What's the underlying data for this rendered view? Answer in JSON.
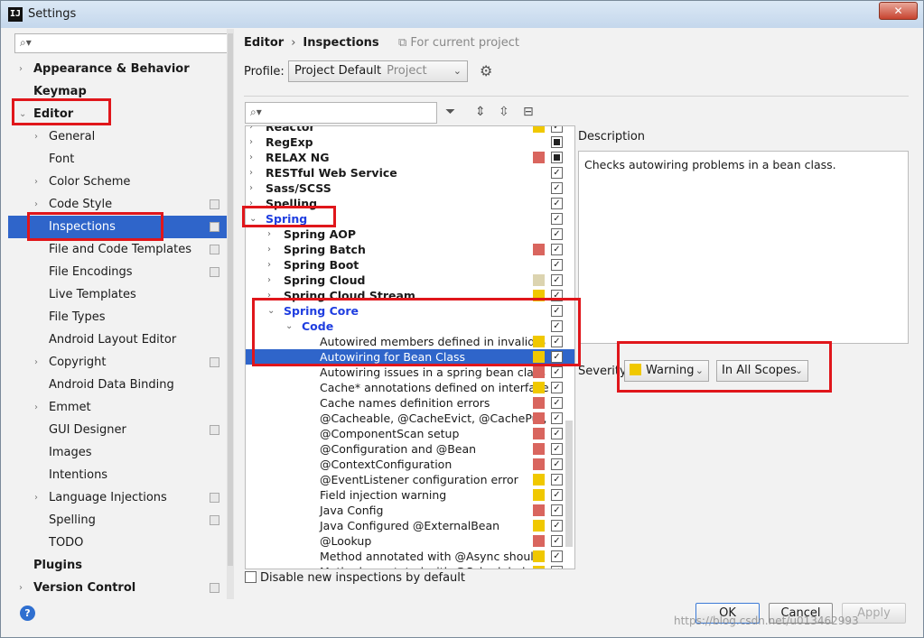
{
  "window": {
    "title": "Settings",
    "app_icon": "IJ",
    "close": "✕"
  },
  "left": {
    "search_placeholder": "",
    "items": [
      {
        "label": "Appearance & Behavior",
        "bold": true,
        "arrow": "›",
        "level": 0
      },
      {
        "label": "Keymap",
        "bold": true,
        "arrow": "",
        "level": 0
      },
      {
        "label": "Editor",
        "bold": true,
        "arrow": "⌄",
        "level": 0
      },
      {
        "label": "General",
        "arrow": "›",
        "level": 1
      },
      {
        "label": "Font",
        "arrow": "",
        "level": 1
      },
      {
        "label": "Color Scheme",
        "arrow": "›",
        "level": 1
      },
      {
        "label": "Code Style",
        "arrow": "›",
        "level": 1,
        "cfg": true
      },
      {
        "label": "Inspections",
        "arrow": "",
        "level": 1,
        "cfg": true,
        "selected": true
      },
      {
        "label": "File and Code Templates",
        "arrow": "",
        "level": 1,
        "cfg": true
      },
      {
        "label": "File Encodings",
        "arrow": "",
        "level": 1,
        "cfg": true
      },
      {
        "label": "Live Templates",
        "arrow": "",
        "level": 1
      },
      {
        "label": "File Types",
        "arrow": "",
        "level": 1
      },
      {
        "label": "Android Layout Editor",
        "arrow": "",
        "level": 1
      },
      {
        "label": "Copyright",
        "arrow": "›",
        "level": 1,
        "cfg": true
      },
      {
        "label": "Android Data Binding",
        "arrow": "",
        "level": 1
      },
      {
        "label": "Emmet",
        "arrow": "›",
        "level": 1
      },
      {
        "label": "GUI Designer",
        "arrow": "",
        "level": 1,
        "cfg": true
      },
      {
        "label": "Images",
        "arrow": "",
        "level": 1
      },
      {
        "label": "Intentions",
        "arrow": "",
        "level": 1
      },
      {
        "label": "Language Injections",
        "arrow": "›",
        "level": 1,
        "cfg": true
      },
      {
        "label": "Spelling",
        "arrow": "",
        "level": 1,
        "cfg": true
      },
      {
        "label": "TODO",
        "arrow": "",
        "level": 1
      },
      {
        "label": "Plugins",
        "bold": true,
        "arrow": "",
        "level": 0
      },
      {
        "label": "Version Control",
        "bold": true,
        "arrow": "›",
        "level": 0,
        "cfg": true
      }
    ]
  },
  "right": {
    "breadcrumb": [
      "Editor",
      "Inspections"
    ],
    "breadcrumb_sep": "›",
    "for_project": "For current project",
    "profile_label": "Profile:",
    "profile_value": "Project Default",
    "profile_sub": "Project",
    "description_label": "Description",
    "description_text": "Checks autowiring problems in a bean class.",
    "severity_label": "Severity:",
    "severity_value": "Warning",
    "scope_value": "In All Scopes",
    "disable_new": "Disable new inspections by default"
  },
  "colors": {
    "warning": "#f0c800",
    "error": "#d9655e",
    "weak": "#dcd4b0",
    "selected": "#2f65ca",
    "spring_blue": "#1f3ee0"
  },
  "inspections": [
    {
      "label": "Reactor",
      "level": 0,
      "arrow": "›",
      "style": "b",
      "sev": "warning",
      "chk": "check",
      "cut": true
    },
    {
      "label": "RegExp",
      "level": 0,
      "arrow": "›",
      "style": "b",
      "sev": "",
      "chk": "square"
    },
    {
      "label": "RELAX NG",
      "level": 0,
      "arrow": "›",
      "style": "b",
      "sev": "error",
      "chk": "square"
    },
    {
      "label": "RESTful Web Service",
      "level": 0,
      "arrow": "›",
      "style": "b",
      "sev": "",
      "chk": "check"
    },
    {
      "label": "Sass/SCSS",
      "level": 0,
      "arrow": "›",
      "style": "b",
      "sev": "",
      "chk": "check"
    },
    {
      "label": "Spelling",
      "level": 0,
      "arrow": "›",
      "style": "b",
      "sev": "",
      "chk": "check"
    },
    {
      "label": "Spring",
      "level": 0,
      "arrow": "⌄",
      "style": "blue",
      "sev": "",
      "chk": "check"
    },
    {
      "label": "Spring AOP",
      "level": 1,
      "arrow": "›",
      "style": "b",
      "sev": "",
      "chk": "check"
    },
    {
      "label": "Spring Batch",
      "level": 1,
      "arrow": "›",
      "style": "b",
      "sev": "error",
      "chk": "check"
    },
    {
      "label": "Spring Boot",
      "level": 1,
      "arrow": "›",
      "style": "b",
      "sev": "",
      "chk": "check"
    },
    {
      "label": "Spring Cloud",
      "level": 1,
      "arrow": "›",
      "style": "b",
      "sev": "weak",
      "chk": "check"
    },
    {
      "label": "Spring Cloud Stream",
      "level": 1,
      "arrow": "›",
      "style": "b",
      "sev": "warning",
      "chk": "check"
    },
    {
      "label": "Spring Core",
      "level": 1,
      "arrow": "⌄",
      "style": "blue",
      "sev": "",
      "chk": "check"
    },
    {
      "label": "Code",
      "level": 2,
      "arrow": "⌄",
      "style": "blue",
      "sev": "",
      "chk": "check"
    },
    {
      "label": "Autowired members defined in invalid S",
      "level": 3,
      "arrow": "",
      "style": "",
      "sev": "warning",
      "chk": "check"
    },
    {
      "label": "Autowiring for Bean Class",
      "level": 3,
      "arrow": "",
      "style": "",
      "sev": "warning",
      "chk": "check",
      "selected": true
    },
    {
      "label": "Autowiring issues in a spring bean class",
      "level": 3,
      "arrow": "",
      "style": "",
      "sev": "error",
      "chk": "check"
    },
    {
      "label": "Cache* annotations defined on interface",
      "level": 3,
      "arrow": "",
      "style": "",
      "sev": "warning",
      "chk": "check"
    },
    {
      "label": "Cache names definition errors",
      "level": 3,
      "arrow": "",
      "style": "",
      "sev": "error",
      "chk": "check"
    },
    {
      "label": "@Cacheable, @CacheEvict, @CachePut,",
      "level": 3,
      "arrow": "",
      "style": "",
      "sev": "error",
      "chk": "check"
    },
    {
      "label": "@ComponentScan setup",
      "level": 3,
      "arrow": "",
      "style": "",
      "sev": "error",
      "chk": "check"
    },
    {
      "label": "@Configuration and @Bean",
      "level": 3,
      "arrow": "",
      "style": "",
      "sev": "error",
      "chk": "check"
    },
    {
      "label": "@ContextConfiguration",
      "level": 3,
      "arrow": "",
      "style": "",
      "sev": "error",
      "chk": "check"
    },
    {
      "label": "@EventListener configuration error",
      "level": 3,
      "arrow": "",
      "style": "",
      "sev": "warning",
      "chk": "check"
    },
    {
      "label": "Field injection warning",
      "level": 3,
      "arrow": "",
      "style": "",
      "sev": "warning",
      "chk": "check"
    },
    {
      "label": "Java Config",
      "level": 3,
      "arrow": "",
      "style": "",
      "sev": "error",
      "chk": "check"
    },
    {
      "label": "Java Configured @ExternalBean",
      "level": 3,
      "arrow": "",
      "style": "",
      "sev": "warning",
      "chk": "check"
    },
    {
      "label": "@Lookup",
      "level": 3,
      "arrow": "",
      "style": "",
      "sev": "error",
      "chk": "check"
    },
    {
      "label": "Method annotated with @Async should",
      "level": 3,
      "arrow": "",
      "style": "",
      "sev": "warning",
      "chk": "check"
    },
    {
      "label": "Method annotated with @Scheduled sh",
      "level": 3,
      "arrow": "",
      "style": "",
      "sev": "warning",
      "chk": "check",
      "cut": true
    }
  ],
  "buttons": {
    "ok": "OK",
    "cancel": "Cancel",
    "apply": "Apply",
    "help": "?"
  },
  "watermark": "https://blog.csdn.net/u013462993"
}
